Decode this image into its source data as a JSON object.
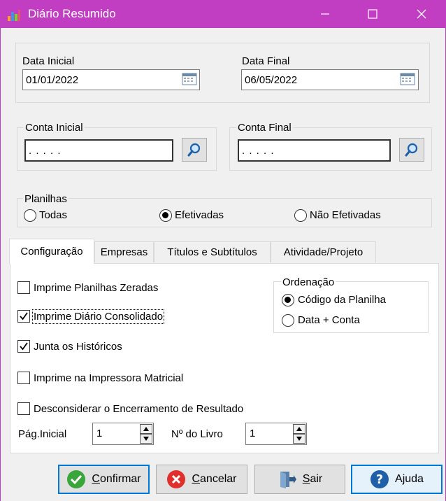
{
  "window": {
    "title": "Diário Resumido",
    "accent": "#c13ec2"
  },
  "dates": {
    "start_label": "Data Inicial",
    "start_value": "01/01/2022",
    "end_label": "Data Final",
    "end_value": "06/05/2022"
  },
  "accounts": {
    "start_label": "Conta Inicial",
    "start_value": ". . . . .",
    "end_label": "Conta Final",
    "end_value": ". . . . ."
  },
  "planilhas": {
    "label": "Planilhas",
    "options": [
      "Todas",
      "Efetivadas",
      "Não Efetivadas"
    ],
    "selected": "Efetivadas"
  },
  "tabs": [
    {
      "label": "Configuração",
      "active": true
    },
    {
      "label": "Empresas",
      "active": false
    },
    {
      "label": "Títulos e Subtítulos",
      "active": false
    },
    {
      "label": "Atividade/Projeto",
      "active": false
    }
  ],
  "config": {
    "checkboxes": [
      {
        "label": "Imprime Planilhas Zeradas",
        "checked": false
      },
      {
        "label": "Imprime Diário Consolidado",
        "checked": true
      },
      {
        "label": "Junta os Históricos",
        "checked": true
      },
      {
        "label": "Imprime na Impressora Matricial",
        "checked": false
      },
      {
        "label": "Desconsiderar o Encerramento de Resultado",
        "checked": false
      }
    ],
    "ordenacao": {
      "label": "Ordenação",
      "options": [
        "Código da Planilha",
        "Data + Conta"
      ],
      "selected": "Código da Planilha"
    },
    "pag_inicial_label": "Pág.Inicial",
    "pag_inicial_value": "1",
    "livro_label": "Nº do Livro",
    "livro_value": "1"
  },
  "buttons": {
    "confirm": "Confirmar",
    "cancel": "Cancelar",
    "exit": "Sair",
    "help": "Ajuda"
  }
}
